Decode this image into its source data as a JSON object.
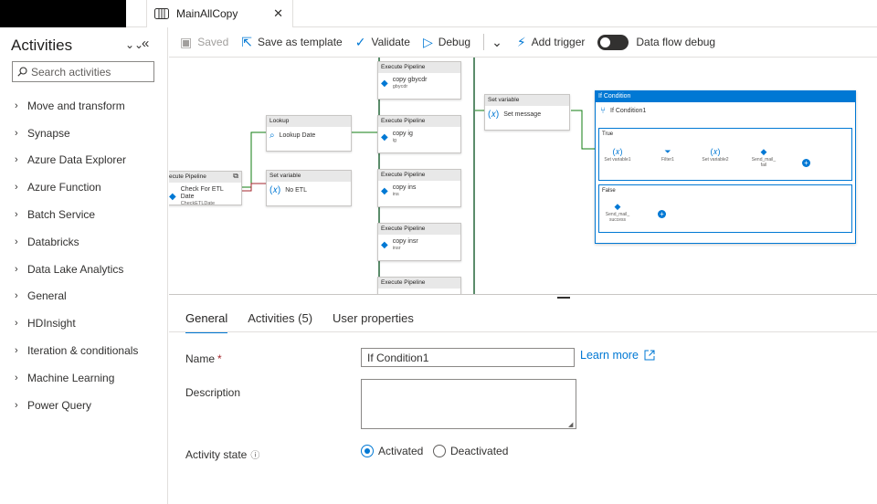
{
  "tab": {
    "title": "MainAllCopy",
    "close": "✕"
  },
  "sidebar": {
    "title": "Activities",
    "search_placeholder": "Search activities",
    "items": [
      {
        "label": "Move and transform"
      },
      {
        "label": "Synapse"
      },
      {
        "label": "Azure Data Explorer"
      },
      {
        "label": "Azure Function"
      },
      {
        "label": "Batch Service"
      },
      {
        "label": "Databricks"
      },
      {
        "label": "Data Lake Analytics"
      },
      {
        "label": "General"
      },
      {
        "label": "HDInsight"
      },
      {
        "label": "Iteration & conditionals"
      },
      {
        "label": "Machine Learning"
      },
      {
        "label": "Power Query"
      }
    ]
  },
  "toolbar": {
    "saved": "Saved",
    "save_template": "Save as template",
    "validate": "Validate",
    "debug": "Debug",
    "add_trigger": "Add trigger",
    "data_flow_debug": "Data flow debug"
  },
  "canvas": {
    "exec_left": {
      "header": "ecute Pipeline",
      "label": "Check For ETL Date",
      "sub": "CheckETLDate"
    },
    "lookup": {
      "header": "Lookup",
      "label": "Lookup Date"
    },
    "setvar_noetl": {
      "header": "Set variable",
      "label": "No ETL"
    },
    "foreach_nodes": [
      {
        "header": "Execute Pipeline",
        "label": "copy gbycdr",
        "sub": "gbycdr"
      },
      {
        "header": "Execute Pipeline",
        "label": "copy ig",
        "sub": "ig"
      },
      {
        "header": "Execute Pipeline",
        "label": "copy ins",
        "sub": "ins"
      },
      {
        "header": "Execute Pipeline",
        "label": "copy insr",
        "sub": "insr"
      },
      {
        "header": "Execute Pipeline",
        "label": "",
        "sub": ""
      }
    ],
    "setvar_msg": {
      "header": "Set variable",
      "label": "Set message"
    },
    "ifcond": {
      "header": "If Condition",
      "name": "If Condition1",
      "true_label": "True",
      "false_label": "False",
      "true_items": [
        "Set variable1",
        "Filter1",
        "Set variable2",
        "Send_mail_ fail"
      ],
      "false_items": [
        "Send_mail_ success"
      ]
    }
  },
  "properties": {
    "tabs": [
      "General",
      "Activities (5)",
      "User properties"
    ],
    "name_label": "Name",
    "name_required": "*",
    "name_value": "If Condition1",
    "learn_more": "Learn more",
    "description_label": "Description",
    "state_label": "Activity state",
    "activated": "Activated",
    "deactivated": "Deactivated"
  }
}
